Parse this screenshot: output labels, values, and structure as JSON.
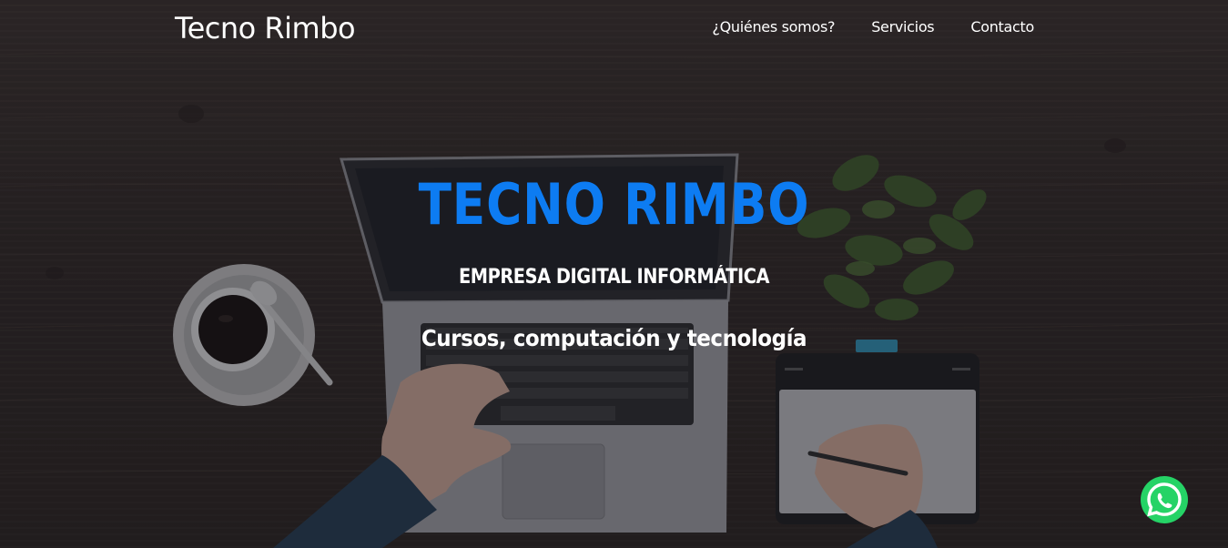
{
  "header": {
    "brand": "Tecno Rimbo",
    "nav": [
      {
        "label": "¿Quiénes somos?"
      },
      {
        "label": "Servicios"
      },
      {
        "label": "Contacto"
      }
    ]
  },
  "hero": {
    "title": "TECNO RIMBO",
    "subtitle": "EMPRESA DIGITAL INFORMÁTICA",
    "tagline": "Cursos, computación y tecnología"
  },
  "floating": {
    "icon": "whatsapp-icon"
  },
  "colors": {
    "title_blue": "#0d7cf2",
    "whatsapp_green": "#25d366",
    "text_white": "#ffffff"
  }
}
